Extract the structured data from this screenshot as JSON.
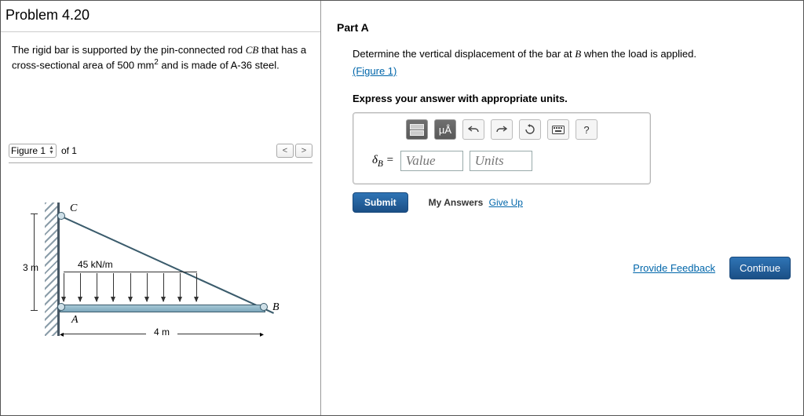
{
  "problem": {
    "title": "Problem 4.20",
    "description_pre": "The rigid bar is supported by the pin-connected rod ",
    "rod_label": "CB",
    "description_mid": " that has a cross-sectional area of 500 mm",
    "area_exp": "2",
    "description_post": " and is made of A-36 steel."
  },
  "figure": {
    "selector_label": "Figure 1",
    "of_label": "of 1",
    "dim_vertical": "3 m",
    "dim_horizontal": "4 m",
    "load_label": "45 kN/m",
    "pointC": "C",
    "pointA": "A",
    "pointB": "B"
  },
  "partA": {
    "heading": "Part A",
    "question_pre": "Determine the vertical displacement of the bar at ",
    "question_point": "B",
    "question_post": " when the load is applied.",
    "figure_link": "(Figure 1)",
    "express": "Express your answer with appropriate units.",
    "toolbar": {
      "units_btn": "µÅ",
      "help": "?"
    },
    "answer": {
      "symbol": "δ",
      "subscript": "B",
      "equals": " = ",
      "value_placeholder": "Value",
      "units_placeholder": "Units"
    },
    "submit_label": "Submit",
    "my_answers": "My Answers",
    "give_up": "Give Up"
  },
  "footer": {
    "feedback": "Provide Feedback",
    "continue": "Continue"
  }
}
